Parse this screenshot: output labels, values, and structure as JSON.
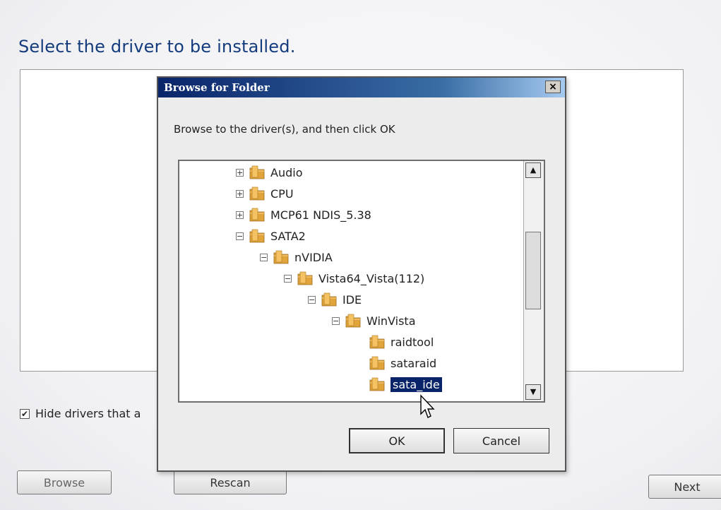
{
  "page": {
    "heading": "Select the driver to be installed.",
    "hide_drivers_label": "Hide drivers that a",
    "hide_drivers_checked": true
  },
  "buttons": {
    "browse": "Browse",
    "rescan": "Rescan",
    "next": "Next"
  },
  "dialog": {
    "title": "Browse for Folder",
    "close_glyph": "×",
    "instruction": "Browse to the driver(s), and then click OK",
    "ok": "OK",
    "cancel": "Cancel",
    "tree": [
      {
        "label": "Audio",
        "expander": "+",
        "depth": 0
      },
      {
        "label": "CPU",
        "expander": "+",
        "depth": 0
      },
      {
        "label": "MCP61 NDIS_5.38",
        "expander": "+",
        "depth": 0
      },
      {
        "label": "SATA2",
        "expander": "−",
        "depth": 0
      },
      {
        "label": "nVIDIA",
        "expander": "−",
        "depth": 1
      },
      {
        "label": "Vista64_Vista(112)",
        "expander": "−",
        "depth": 2
      },
      {
        "label": "IDE",
        "expander": "−",
        "depth": 3
      },
      {
        "label": "WinVista",
        "expander": "−",
        "depth": 4
      },
      {
        "label": "raidtool",
        "expander": "",
        "depth": 5
      },
      {
        "label": "sataraid",
        "expander": "",
        "depth": 5
      },
      {
        "label": "sata_ide",
        "expander": "",
        "depth": 5,
        "selected": true
      }
    ],
    "scroll_up": "▲",
    "scroll_down": "▼"
  },
  "colors": {
    "heading": "#143b7c",
    "title_bar": "#0a246a",
    "selection": "#0a246a",
    "folder": "#e0a43a"
  }
}
